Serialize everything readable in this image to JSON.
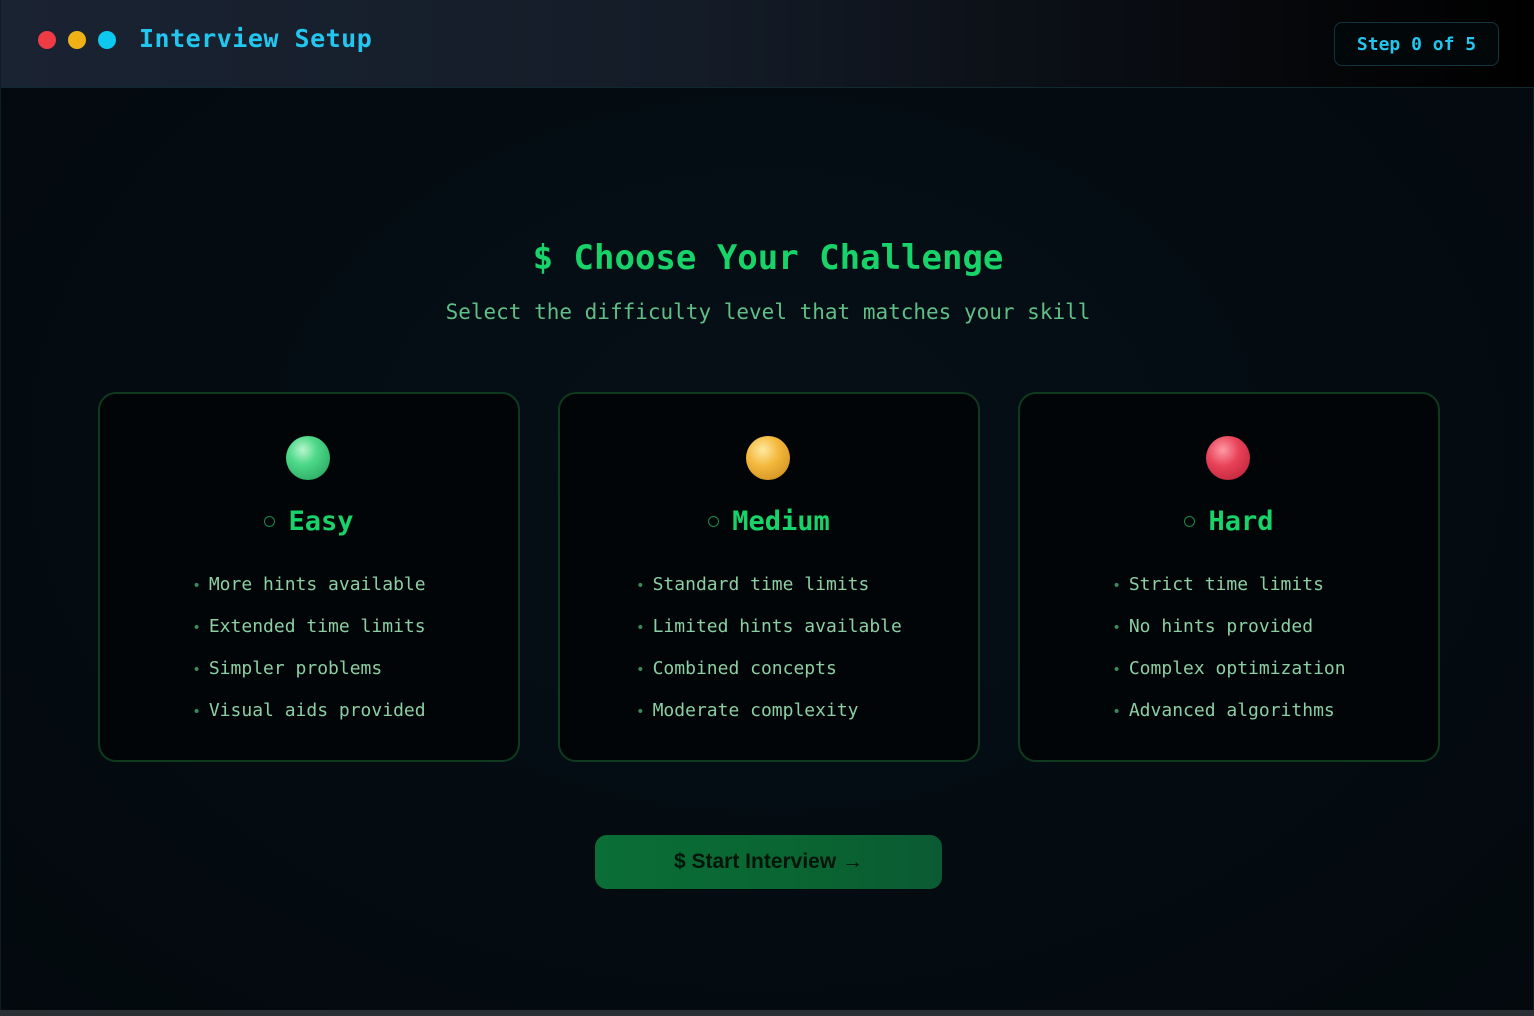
{
  "window": {
    "title": "Interview Setup",
    "step": "Step 0 of 5"
  },
  "main": {
    "heading": "$ Choose Your Challenge",
    "subheading": "Select the difficulty level that matches your skill"
  },
  "levels": [
    {
      "name": "Easy",
      "color": "#4fd98a",
      "features": [
        "More hints available",
        "Extended time limits",
        "Simpler problems",
        "Visual aids provided"
      ]
    },
    {
      "name": "Medium",
      "color": "#f3b83c",
      "features": [
        "Standard time limits",
        "Limited hints available",
        "Combined concepts",
        "Moderate complexity"
      ]
    },
    {
      "name": "Hard",
      "color": "#e84258",
      "features": [
        "Strict time limits",
        "No hints provided",
        "Complex optimization",
        "Advanced algorithms"
      ]
    }
  ],
  "actions": {
    "start_label": "$ Start Interview →"
  },
  "colors": {
    "accent_green": "#18d36a",
    "accent_cyan": "#22c6ee",
    "traffic_red": "#ef3b45",
    "traffic_yellow": "#efb115",
    "traffic_cyan": "#0fc8ef"
  }
}
